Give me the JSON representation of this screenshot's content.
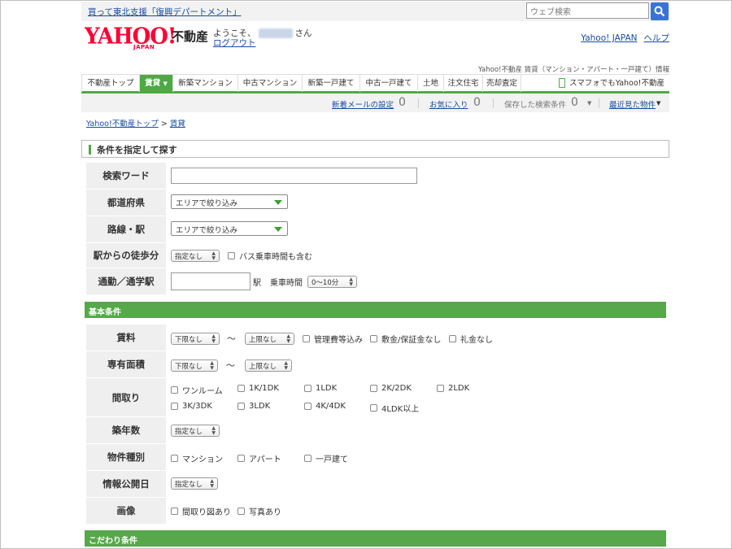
{
  "top": {
    "campaign_link": "買って東北支援「復興デパートメント」",
    "search_placeholder": "ウェブ検索"
  },
  "header": {
    "logo_text": "YAHOO!",
    "logo_sub": "JAPAN",
    "site_name": "不動産",
    "welcome_prefix": "ようこそ、",
    "welcome_suffix": "さん",
    "logout": "ログアウト",
    "links": [
      "Yahoo! JAPAN",
      "ヘルプ"
    ],
    "tagline": "Yahoo!不動産 賃貸（マンション・アパート・一戸建て）情報"
  },
  "nav": {
    "items": [
      {
        "label": "不動産トップ",
        "active": false
      },
      {
        "label": "賃貸",
        "active": true
      },
      {
        "label": "新築マンション",
        "active": false
      },
      {
        "label": "中古マンション",
        "active": false
      },
      {
        "label": "新築一戸建て",
        "active": false
      },
      {
        "label": "中古一戸建て",
        "active": false
      },
      {
        "label": "土地",
        "active": false
      },
      {
        "label": "注文住宅",
        "active": false
      },
      {
        "label": "売却査定",
        "active": false
      }
    ],
    "mobile": "スマフォでもYahoo!不動産"
  },
  "subbar": {
    "new_mail": "新着メールの設定",
    "new_mail_count": "0",
    "favorites": "お気に入り",
    "favorites_count": "0",
    "saved": "保存した検索条件",
    "saved_count": "0",
    "recent": "最近見た物件"
  },
  "breadcrumb": {
    "home": "Yahoo!不動産トップ",
    "sep": ">",
    "current": "賃貸"
  },
  "search": {
    "title": "条件を指定して探す",
    "keyword_label": "検索ワード",
    "pref_label": "都道府県",
    "pref_value": "エリアで絞り込み",
    "line_label": "路線・駅",
    "line_value": "エリアで絞り込み",
    "walk_label": "駅からの徒歩分",
    "walk_value": "指定なし",
    "bus_label": "バス乗車時間も含む",
    "commute_label": "通勤／通学駅",
    "station_suffix": "駅",
    "ride_label": "乗車時間",
    "ride_value": "0〜10分"
  },
  "basic": {
    "title": "基本条件",
    "rent_label": "賃料",
    "rent_min": "下限なし",
    "rent_max": "上限なし",
    "tilde": "〜",
    "rent_options": [
      "管理費等込み",
      "敷金/保証金なし",
      "礼金なし"
    ],
    "area_label": "専有面積",
    "area_min": "下限なし",
    "area_max": "上限なし",
    "layout_label": "間取り",
    "layouts_row1": [
      "ワンルーム",
      "1K/1DK",
      "1LDK",
      "2K/2DK",
      "2LDK"
    ],
    "layouts_row2": [
      "3K/3DK",
      "3LDK",
      "4K/4DK",
      "4LDK以上"
    ],
    "age_label": "築年数",
    "age_value": "指定なし",
    "type_label": "物件種別",
    "types": [
      "マンション",
      "アパート",
      "一戸建て"
    ],
    "published_label": "情報公開日",
    "published_value": "指定なし",
    "image_label": "画像",
    "images": [
      "間取り図あり",
      "写真あり"
    ]
  },
  "special": {
    "title": "こだわり条件"
  },
  "colors": {
    "accent_green": "#4ea944",
    "link_blue": "#1a4da0",
    "logo_red": "#ff0033"
  }
}
